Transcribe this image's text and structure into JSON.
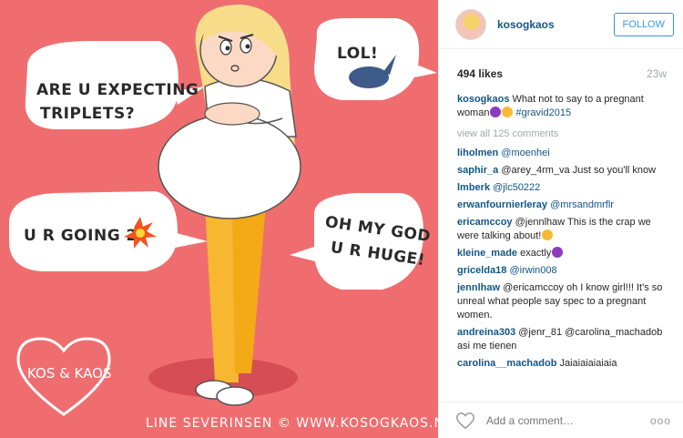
{
  "image": {
    "bubbles": {
      "triplets_line1": "ARE U EXPECTING",
      "triplets_line2": "TRIPLETS?",
      "lol": "LOL!",
      "going_to": "U R GOING 2",
      "omg_line1": "OH MY GOD",
      "omg_line2": "U R HUGE!"
    },
    "logo": "KOS & KAOS",
    "credit": "LINE SEVERINSEN © WWW.KOSOGKAOS.NO",
    "background_color": "#f06d6f"
  },
  "header": {
    "username": "kosogkaos",
    "follow_label": "FOLLOW"
  },
  "meta": {
    "likes": "494 likes",
    "age": "23w"
  },
  "caption": {
    "user": "kosogkaos",
    "text": "What not to say to a pregnant woman",
    "hashtag": "#gravid2015"
  },
  "view_all": "view all 125 comments",
  "comments": [
    {
      "user": "liholmen",
      "text": "@moenhei"
    },
    {
      "user": "saphir_a",
      "text": "@arey_4rm_va Just so you'll know"
    },
    {
      "user": "lmberk",
      "text": "@jlc50222"
    },
    {
      "user": "erwanfournierleray",
      "text": "@mrsandmrflr"
    },
    {
      "user": "ericamccoy",
      "text": "@jennlhaw This is the crap we were talking about!"
    },
    {
      "user": "kleine_made",
      "text": "exactly"
    },
    {
      "user": "gricelda18",
      "text": "@irwin008"
    },
    {
      "user": "jennlhaw",
      "text": "@ericamccoy oh I know girl!!! It's so unreal what people say spec to a pregnant women."
    },
    {
      "user": "andreina303",
      "text": "@jenr_81 @carolina_machadob asi me tienen"
    },
    {
      "user": "carolina__machadob",
      "text": "Jaiaiaiaiaiaia"
    }
  ],
  "add_comment": {
    "placeholder": "Add a comment…",
    "more": "ooo"
  }
}
